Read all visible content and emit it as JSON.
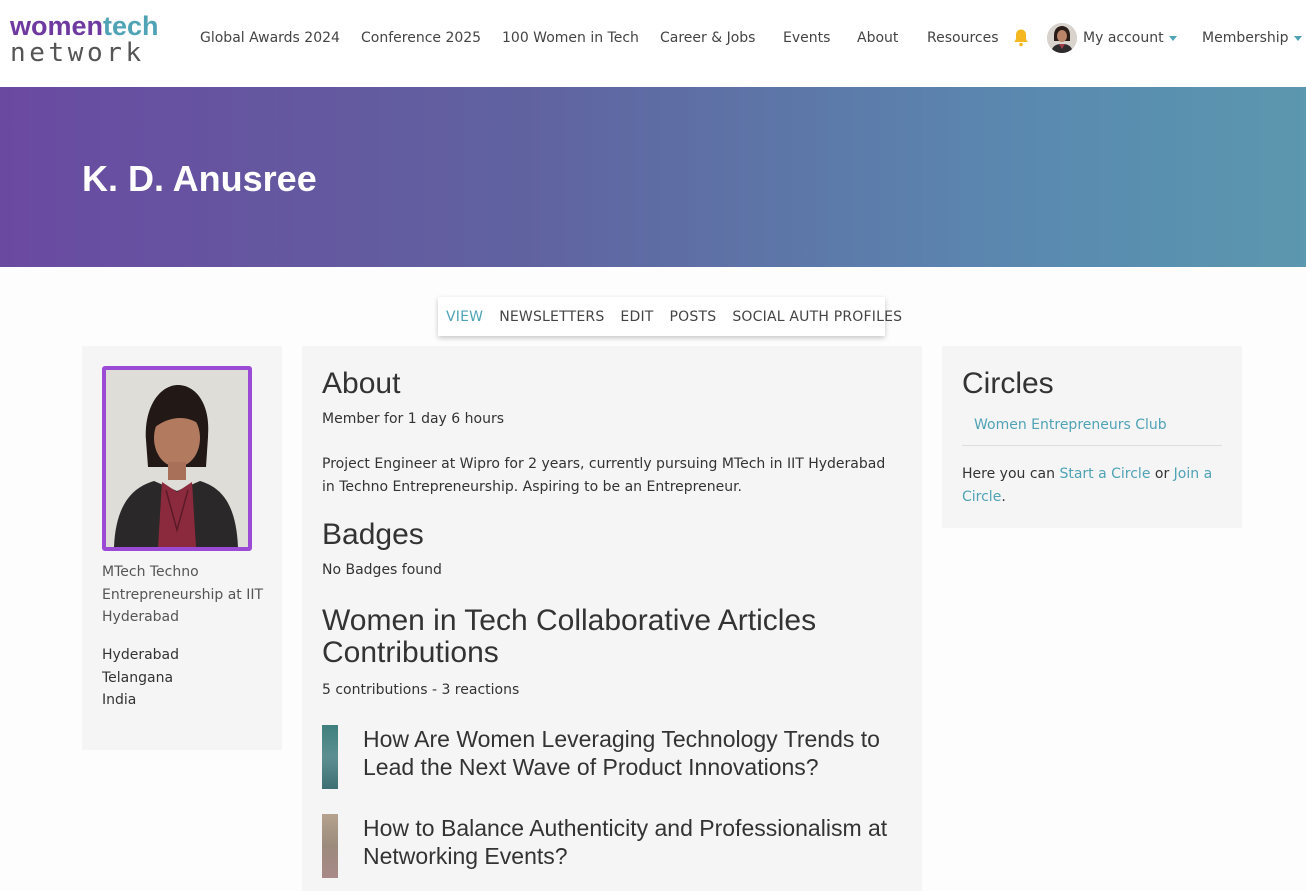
{
  "logo": {
    "line1_part1": "women",
    "line1_part2": "tech",
    "line2": "network"
  },
  "nav": {
    "items": [
      "Global Awards 2024",
      "Conference 2025",
      "100 Women in Tech",
      "Career & Jobs",
      "Events",
      "About",
      "Resources"
    ],
    "account_label": "My account",
    "membership_label": "Membership"
  },
  "banner": {
    "title": "K. D. Anusree"
  },
  "tabs": [
    "VIEW",
    "NEWSLETTERS",
    "EDIT",
    "POSTS",
    "SOCIAL AUTH PROFILES"
  ],
  "profile": {
    "headline": "MTech Techno Entrepreneurship at IIT Hyderabad",
    "city": "Hyderabad",
    "state": "Telangana",
    "country": "India"
  },
  "about": {
    "heading": "About",
    "member_for": "Member for 1 day 6 hours",
    "bio": "Project Engineer at Wipro for 2 years, currently pursuing MTech in IIT Hyderabad in Techno Entrepreneurship. Aspiring to be an Entrepreneur."
  },
  "badges": {
    "heading": "Badges",
    "empty_text": "No Badges found"
  },
  "articles": {
    "heading": "Women in Tech Collaborative Articles Contributions",
    "stats": "5 contributions - 3 reactions",
    "items": [
      "How Are Women Leveraging Technology Trends to Lead the Next Wave of Product Innovations?",
      "How to Balance Authenticity and Professionalism at Networking Events?"
    ]
  },
  "circles": {
    "heading": "Circles",
    "items": [
      "Women Entrepreneurs Club"
    ],
    "text_before": "Here you can ",
    "start_link": "Start a Circle",
    "text_middle": " or ",
    "join_link": "Join a Circle",
    "text_after": "."
  },
  "colors": {
    "brand_purple": "#6e3aa0",
    "accent_teal": "#4fa3b5",
    "photo_border": "#9b4ad6",
    "bell": "#f5b820"
  }
}
